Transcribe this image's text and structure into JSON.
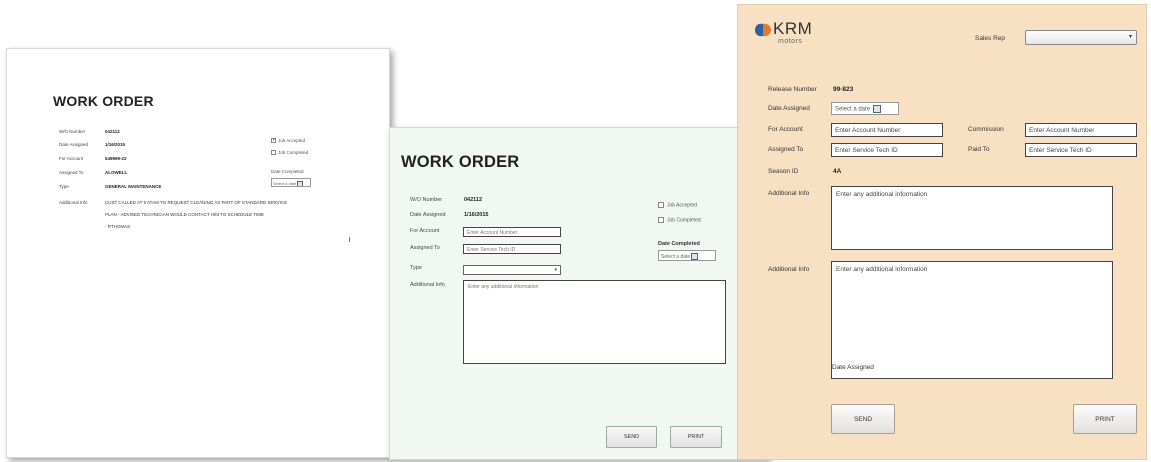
{
  "card_left": {
    "title": "WORK ORDER",
    "fields": [
      {
        "label": "W/O Number",
        "value": "042112"
      },
      {
        "label": "Date Assigned",
        "value": "1/16/2015"
      },
      {
        "label": "For Account",
        "value": "549999-22"
      },
      {
        "label": "Assigned To",
        "value": "ALOWELL"
      },
      {
        "label": "Type",
        "value": "GENERAL MAINTENANCE"
      }
    ],
    "additional_info_label": "Additional Info",
    "additional_info_lines": [
      "CUST CALLED AT 9 ATAM TO REQUEST CLEANING AS PART OF STANDARD SERVICE",
      "PLAN - ADVISED TECHNICIAN WOULD CONTACT HIM TO SCHEDULE TIME",
      "- RTHOMAS"
    ],
    "job_accepted_label": "Job Accepted",
    "job_accepted_checked": true,
    "job_completed_label": "Job Completed",
    "date_completed_label": "Date Completed",
    "date_placeholder": "Select a date"
  },
  "card_middle": {
    "title": "WORK ORDER",
    "wo_number_label": "W/O Number",
    "wo_number_value": "042112",
    "date_assigned_label": "Date Assigned",
    "date_assigned_value": "1/16/2015",
    "for_account_label": "For Account",
    "for_account_placeholder": "Enter Account Number",
    "assigned_to_label": "Assigned To",
    "assigned_to_placeholder": "Enter Service Tech ID",
    "type_label": "Type",
    "additional_info_label": "Additional Info",
    "additional_info_placeholder": "Enter any additional information",
    "job_accepted_label": "Job Accepted",
    "job_completed_label": "Job Completed",
    "date_completed_label": "Date Completed",
    "date_placeholder": "Select a date",
    "send_label": "SEND",
    "print_label": "PRINT"
  },
  "card_right": {
    "brand_word": "KRM",
    "brand_sub": "motors",
    "sales_rep_label": "Sales Rep",
    "release_number_label": "Release Number",
    "release_number_value": "99-823",
    "date_assigned_label": "Date Assigned",
    "date_placeholder": "Select a date",
    "for_account_label": "For Account",
    "for_account_placeholder": "Enter Account Number",
    "commission_label": "Commission",
    "commission_placeholder": "Enter Account Number",
    "assigned_to_label": "Assigned To",
    "assigned_to_placeholder": "Enter Service Tech ID",
    "paid_to_label": "Paid To",
    "paid_to_placeholder": "Enter Service Tech ID",
    "season_id_label": "Season ID",
    "season_id_value": "4A",
    "additional_info_label_1": "Additional Info",
    "additional_info_placeholder_1": "Enter any additional information",
    "additional_info_label_2": "Additional Info",
    "additional_info_placeholder_2": "Enter any additional information",
    "date_assigned_bottom_label": "Date Assigned",
    "send_label": "SEND",
    "print_label": "PRINT",
    "colors": {
      "background": "#f8e1c3",
      "logo_blue": "#2f5fa8",
      "logo_orange": "#e8772e"
    }
  }
}
